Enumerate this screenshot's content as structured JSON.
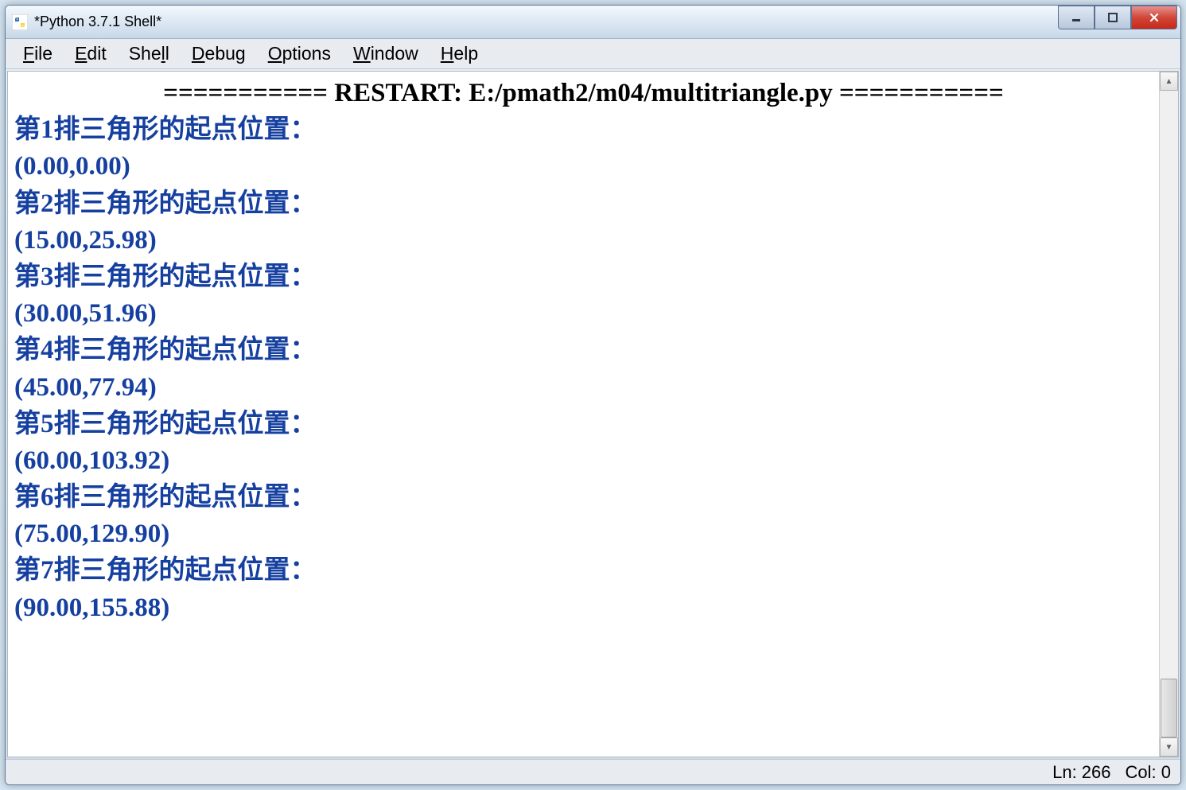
{
  "window": {
    "title": "*Python 3.7.1 Shell*"
  },
  "menu": {
    "file": "File",
    "edit": "Edit",
    "shell": "Shell",
    "debug": "Debug",
    "options": "Options",
    "window": "Window",
    "help": "Help"
  },
  "content": {
    "restart_prefix": "===========",
    "restart_label": " RESTART: E:/pmath2/m04/multitriangle.py ",
    "restart_suffix": "===========",
    "lines": [
      "第1排三角形的起点位置：",
      "(0.00,0.00)",
      "第2排三角形的起点位置：",
      "(15.00,25.98)",
      "第3排三角形的起点位置：",
      "(30.00,51.96)",
      "第4排三角形的起点位置：",
      "(45.00,77.94)",
      "第5排三角形的起点位置：",
      "(60.00,103.92)",
      "第6排三角形的起点位置：",
      "(75.00,129.90)",
      "第7排三角形的起点位置：",
      "(90.00,155.88)"
    ]
  },
  "status": {
    "line": "Ln: 266",
    "col": "Col: 0"
  }
}
